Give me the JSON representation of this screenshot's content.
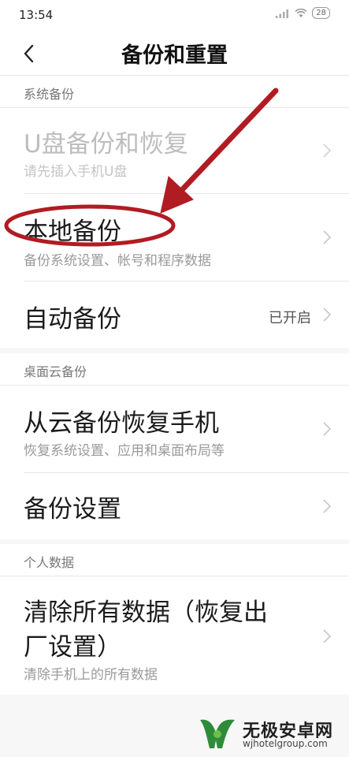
{
  "status": {
    "time": "13:54",
    "battery": "28"
  },
  "header": {
    "title": "备份和重置"
  },
  "sections": [
    {
      "header": "系统备份",
      "items": [
        {
          "title": "U盘备份和恢复",
          "subtitle": "请先插入手机U盘"
        },
        {
          "title": "本地备份",
          "subtitle": "备份系统设置、帐号和程序数据"
        },
        {
          "title": "自动备份",
          "value": "已开启"
        }
      ]
    },
    {
      "header": "桌面云备份",
      "items": [
        {
          "title": "从云备份恢复手机",
          "subtitle": "恢复系统设置、应用和桌面布局等"
        },
        {
          "title": "备份设置"
        }
      ]
    },
    {
      "header": "个人数据",
      "items": [
        {
          "title_line1": "清除所有数据（恢复出",
          "title_line2": "厂设置）",
          "subtitle": "清除手机上的所有数据"
        }
      ]
    }
  ],
  "annotation": {
    "color": "#b01c22"
  },
  "watermark": {
    "title": "无极安卓网",
    "url": "wjhotelgroup.com"
  }
}
